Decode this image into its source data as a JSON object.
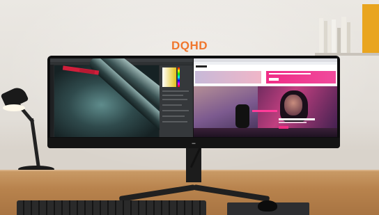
{
  "caption": {
    "headline": "DQHD"
  },
  "scene": {
    "accent_color": "#f0772e",
    "objects": {
      "monitor": "curved-ultrawide-monitor",
      "lamp": "desk-lamp-icon",
      "keyboard": "keyboard",
      "mouse": "mouse",
      "shelf": "wall-shelf-with-books"
    }
  },
  "screen": {
    "left_app": "photo-editor-window",
    "right_app": "web-browser-window"
  }
}
